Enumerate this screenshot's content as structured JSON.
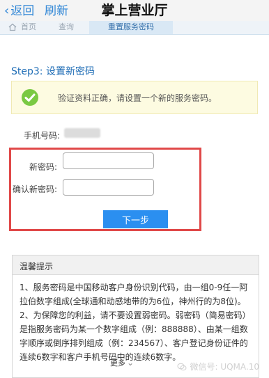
{
  "header": {
    "back_label": "返回",
    "refresh_label": "刷新",
    "title": "掌上营业厅"
  },
  "breadcrumb": {
    "items": [
      "首页",
      "查询",
      "重置服务密码"
    ]
  },
  "step": {
    "title": "Step3: 设置新密码"
  },
  "notice": {
    "text": "验证资料正确，请设置一个新的服务密码。",
    "icon": "check-circle-icon",
    "color": "#7ac943"
  },
  "form": {
    "phone_label": "手机号码:",
    "new_password_label": "新密码:",
    "confirm_password_label": "确认新密码:",
    "new_password_value": "",
    "confirm_password_value": "",
    "next_button": "下一步",
    "highlight_color": "#e04848",
    "button_color": "#2b8ff0"
  },
  "tips": {
    "title": "温馨提示",
    "paragraphs": [
      "1、服务密码是中国移动客户身份识别代码，由一组0-9任一阿拉伯数字组成(全球通和动感地带的为6位，神州行的为8位)。",
      "2、为保障您的利益，请不要设置弱密码。弱密码（简易密码）是指服务密码为某一个数字组成（例：888888）、由某一组数字顺序或倒序排列组成（例：234567）、客户登记身份证件的连续6数字和客户手机号码中的连续6数字。"
    ],
    "more_label": "更多"
  },
  "watermark": {
    "text": "微信号: UQMA.10"
  }
}
